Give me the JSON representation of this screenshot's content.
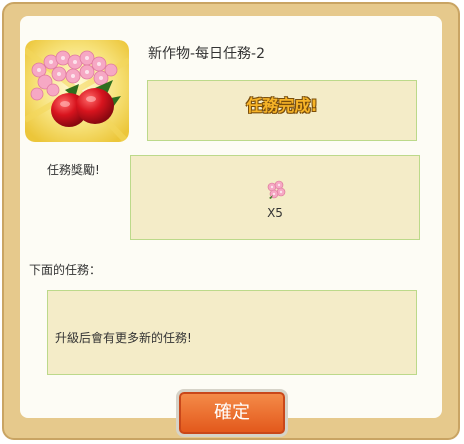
{
  "quest": {
    "title": "新作物-每日任務-2",
    "status_text": "任務完成!",
    "icon": "strawberry-blossom-icon"
  },
  "reward": {
    "label": "任務獎勵!",
    "item_icon": "blossom-icon",
    "count_text": "X5"
  },
  "next": {
    "label": "下面的任務：",
    "text": "升級后會有更多新的任務!"
  },
  "buttons": {
    "confirm_label": "確定"
  },
  "colors": {
    "frame": "#e6c98c",
    "panel": "#fdfcf5",
    "box_fill": "#f4ecc8",
    "box_border": "#bcd98a",
    "status_text": "#f7b428",
    "button": "#e2561a"
  }
}
